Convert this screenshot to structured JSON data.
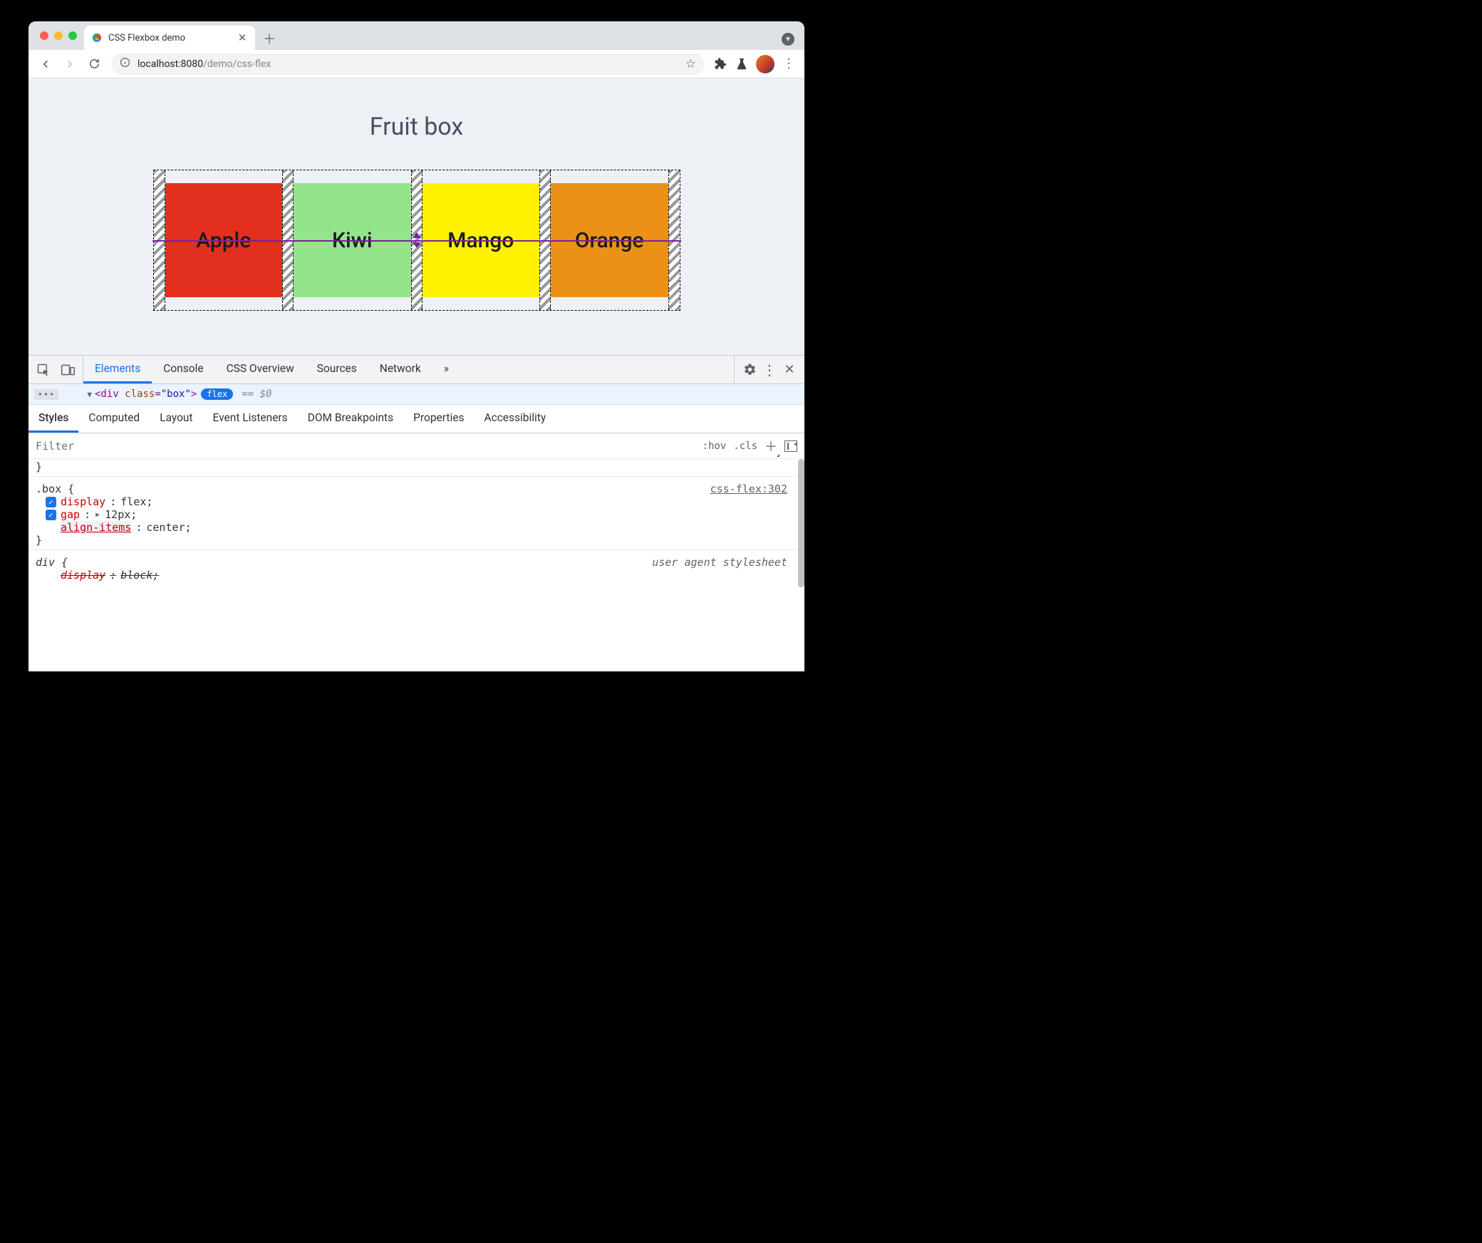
{
  "browser": {
    "tab_title": "CSS Flexbox demo",
    "url_host": "localhost:",
    "url_port": "8080",
    "url_path": "/demo/css-flex"
  },
  "page": {
    "heading": "Fruit box",
    "items": [
      {
        "label": "Apple",
        "color": "#e32f1e"
      },
      {
        "label": "Kiwi",
        "color": "#94e48b"
      },
      {
        "label": "Mango",
        "color": "#fff200"
      },
      {
        "label": "Orange",
        "color": "#ec9118"
      }
    ]
  },
  "devtools": {
    "panel_tabs": [
      "Elements",
      "Console",
      "CSS Overview",
      "Sources",
      "Network"
    ],
    "overflow_label": "»",
    "elements_snippet": {
      "tag_open": "<div",
      "attr_name": "class",
      "attr_val": "\"box\"",
      "tag_close": ">",
      "flex_badge": "flex",
      "$0": "== $0",
      "tri": "▼"
    },
    "styles_tabs": [
      "Styles",
      "Computed",
      "Layout",
      "Event Listeners",
      "DOM Breakpoints",
      "Properties",
      "Accessibility"
    ],
    "filter_placeholder": "Filter",
    "hov_label": ":hov",
    "cls_label": ".cls",
    "rule_box": {
      "selector": ".box {",
      "source": "css-flex:302",
      "props": [
        {
          "checked": true,
          "name": "display",
          "value": "flex;",
          "expand": false
        },
        {
          "checked": true,
          "name": "gap",
          "value": "12px;",
          "expand": true
        },
        {
          "checked": false,
          "name": "align-items",
          "value": "center;",
          "expand": false,
          "highlight": true
        }
      ],
      "close": "}"
    },
    "prev_close": "}",
    "rule_div": {
      "selector": "div {",
      "source": "user agent stylesheet",
      "props": [
        {
          "name": "display",
          "value": "block;",
          "strike": true
        }
      ]
    }
  }
}
